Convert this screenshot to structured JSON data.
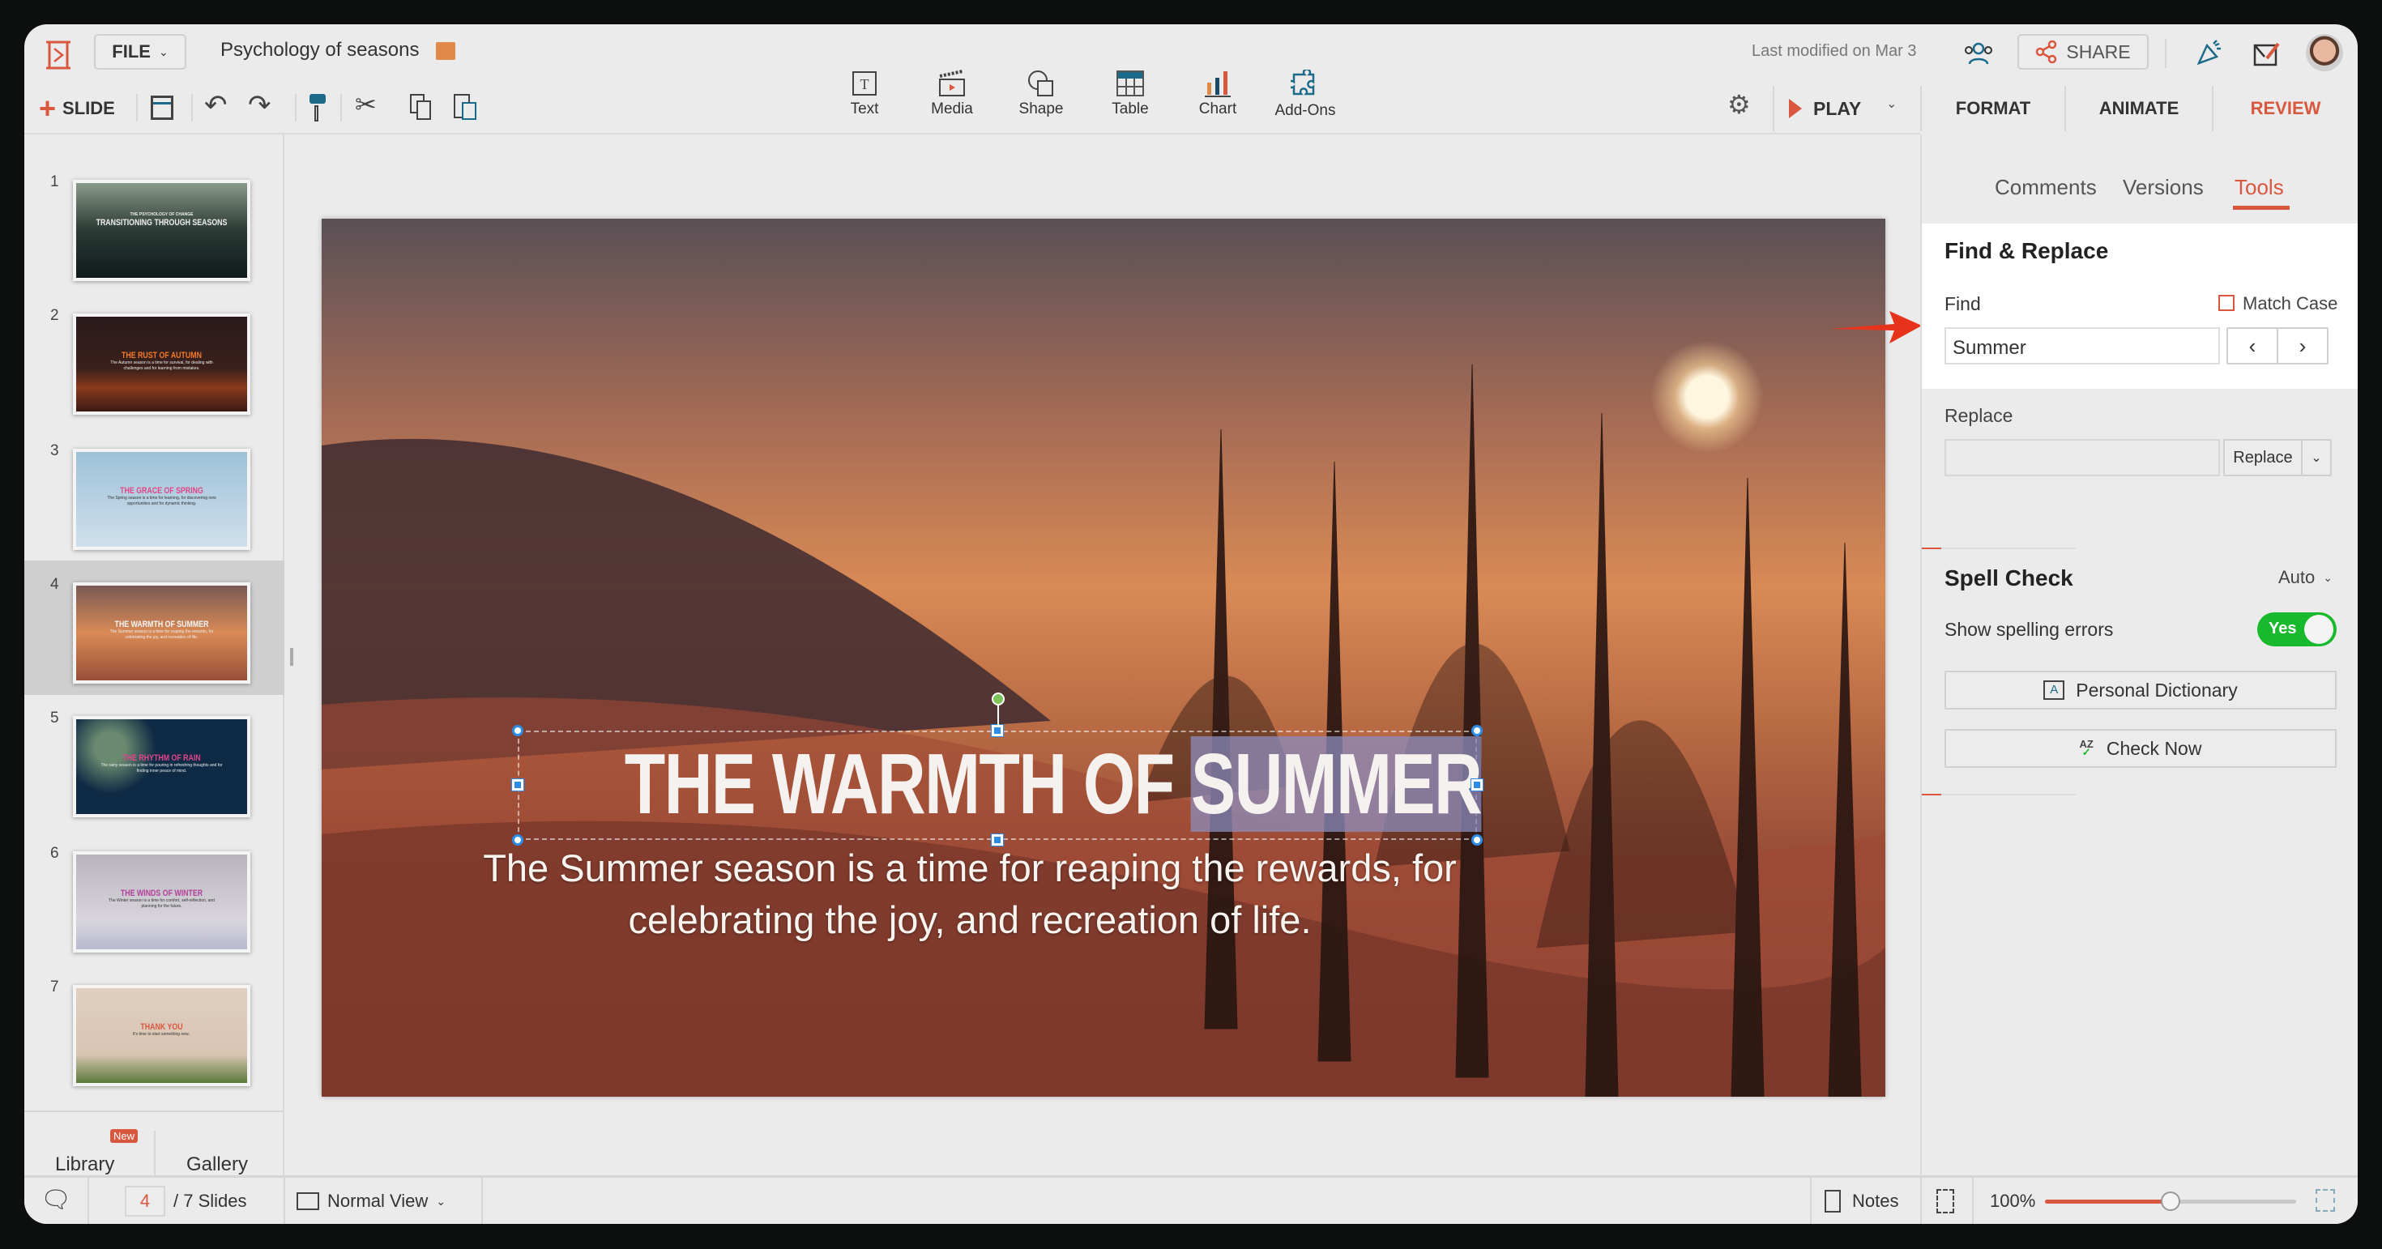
{
  "header": {
    "file_menu": "FILE",
    "doc_title": "Psychology of seasons",
    "last_modified": "Last modified on Mar 3",
    "share": "SHARE"
  },
  "toolbar": {
    "slide": "SLIDE",
    "insert": [
      {
        "label": "Text",
        "icon": "text-box-icon"
      },
      {
        "label": "Media",
        "icon": "media-clapper-icon"
      },
      {
        "label": "Shape",
        "icon": "shape-icon"
      },
      {
        "label": "Table",
        "icon": "table-icon"
      },
      {
        "label": "Chart",
        "icon": "bar-chart-icon"
      },
      {
        "label": "Add-Ons",
        "icon": "puzzle-icon"
      }
    ],
    "play": "PLAY"
  },
  "right_tabs": {
    "format": "FORMAT",
    "animate": "ANIMATE",
    "review": "REVIEW",
    "active": "REVIEW"
  },
  "review_tabs": {
    "comments": "Comments",
    "versions": "Versions",
    "tools": "Tools",
    "active": "Tools"
  },
  "find_replace": {
    "title": "Find & Replace",
    "find_label": "Find",
    "match_case": "Match Case",
    "match_case_checked": false,
    "find_value": "Summer",
    "replace_label": "Replace",
    "replace_value": "",
    "replace_button": "Replace"
  },
  "spell_check": {
    "title": "Spell Check",
    "mode": "Auto",
    "show_errors_label": "Show spelling errors",
    "toggle": "Yes",
    "toggle_on": true,
    "personal_dictionary": "Personal Dictionary",
    "check_now": "Check Now"
  },
  "slides": [
    {
      "num": "1",
      "kicker": "THE PSYCHOLOGY OF CHANGE",
      "title": "TRANSITIONING THROUGH SEASONS",
      "text": ""
    },
    {
      "num": "2",
      "title": "THE RUST OF AUTUMN",
      "text": "The Autumn season is a time for survival, for dealing with challenges and for learning from mistakes."
    },
    {
      "num": "3",
      "title": "THE GRACE OF SPRING",
      "text": "The Spring season is a time for learning, for discovering new opportunities and for dynamic thinking."
    },
    {
      "num": "4",
      "title": "THE WARMTH OF SUMMER",
      "text": "The Summer season is a time for reaping the rewards, for celebrating the joy, and recreation of life."
    },
    {
      "num": "5",
      "title": "THE RHYTHM OF RAIN",
      "text": "The rainy season is a time for pouring in refreshing thoughts and for finding inner peace of mind."
    },
    {
      "num": "6",
      "title": "THE WINDS OF WINTER",
      "text": "The Winter season is a time for comfort, self-reflection, and planning for the future."
    },
    {
      "num": "7",
      "title": "THANK YOU",
      "text": "It's time to start something new.."
    }
  ],
  "sidebar": {
    "library": "Library",
    "library_badge": "New",
    "gallery": "Gallery"
  },
  "canvas": {
    "title_plain": "THE WARMTH OF ",
    "title_highlight": "SUMMER",
    "subtitle_line1": "The Summer season is a time for reaping the rewards, for",
    "subtitle_line2": "celebrating the joy, and recreation of life."
  },
  "status": {
    "current_slide": "4",
    "total": "/ 7 Slides",
    "view": "Normal View",
    "notes": "Notes",
    "zoom": "100%",
    "zoom_percent": 100
  },
  "colors": {
    "accent": "#d9573f",
    "toggle": "#18b92c",
    "selection": "#2d8ce8"
  }
}
